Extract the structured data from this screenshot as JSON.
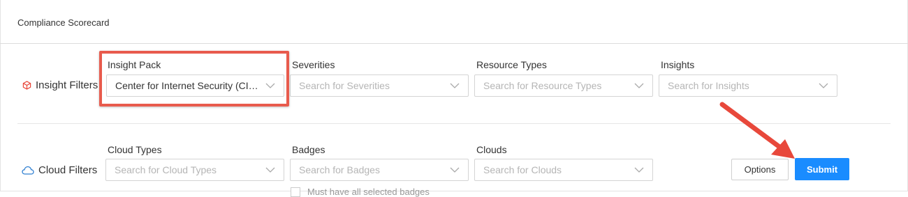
{
  "page": {
    "title": "Compliance Scorecard"
  },
  "insight_filters": {
    "label": "Insight Filters",
    "icon": "cube-icon",
    "fields": {
      "insight_pack": {
        "label": "Insight Pack",
        "value": "Center for Internet Security (CIS) ..."
      },
      "severities": {
        "label": "Severities",
        "placeholder": "Search for Severities"
      },
      "resource_types": {
        "label": "Resource Types",
        "placeholder": "Search for Resource Types"
      },
      "insights": {
        "label": "Insights",
        "placeholder": "Search for Insights"
      }
    }
  },
  "cloud_filters": {
    "label": "Cloud Filters",
    "icon": "cloud-icon",
    "fields": {
      "cloud_types": {
        "label": "Cloud Types",
        "placeholder": "Search for Cloud Types"
      },
      "badges": {
        "label": "Badges",
        "placeholder": "Search for Badges"
      },
      "clouds": {
        "label": "Clouds",
        "placeholder": "Search for Clouds"
      }
    },
    "badges_checkbox_label": "Must have all selected badges"
  },
  "actions": {
    "options_label": "Options",
    "submit_label": "Submit"
  },
  "colors": {
    "accent": "#1a8cff",
    "highlight": "#e85b4d",
    "icon_red": "#e8483b",
    "icon_blue": "#2f7fd1"
  }
}
